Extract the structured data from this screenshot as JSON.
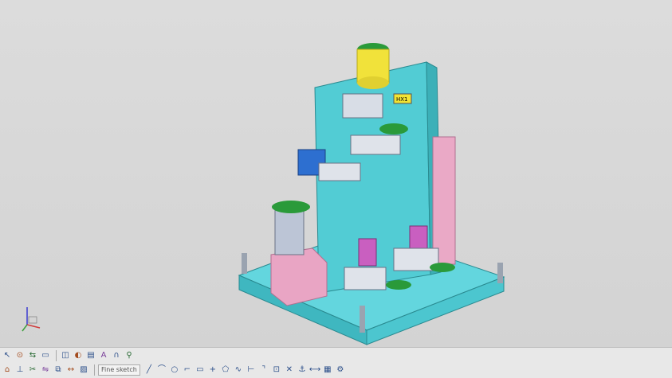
{
  "viewport": {
    "background": "#d6d6d6",
    "model": {
      "plate_color": "#5fd3dc",
      "column_color": "#4fc8d0",
      "pink_block_color": "#e8a9c4",
      "magenta_bracket_color": "#c95fc0",
      "green_handle_color": "#2a9a3a",
      "yellow_part_color": "#f2e433",
      "blue_block_color": "#2d6fd0",
      "label_text": "HX1"
    }
  },
  "toolbar": {
    "row1_icons": [
      "select-icon",
      "snap-icon",
      "transform-icon",
      "drawing-icon",
      "view-icon",
      "shading-icon",
      "layer-icon",
      "annotate-icon",
      "magnet-icon",
      "analysis-icon"
    ],
    "fine_sketch_label": "Fine sketch",
    "row2_icons": [
      "profile-icon",
      "line-icon",
      "arc-icon",
      "circle-icon",
      "corner-icon",
      "rectangle-icon",
      "point-icon",
      "polygon-icon",
      "spline-icon",
      "constraint-icon",
      "trim-icon",
      "mirror-icon",
      "offset-icon",
      "dimension-icon",
      "hatch-icon"
    ]
  },
  "compass": {
    "x_color": "#d03c3c",
    "y_color": "#3ca03c",
    "z_color": "#3c3cd0"
  }
}
